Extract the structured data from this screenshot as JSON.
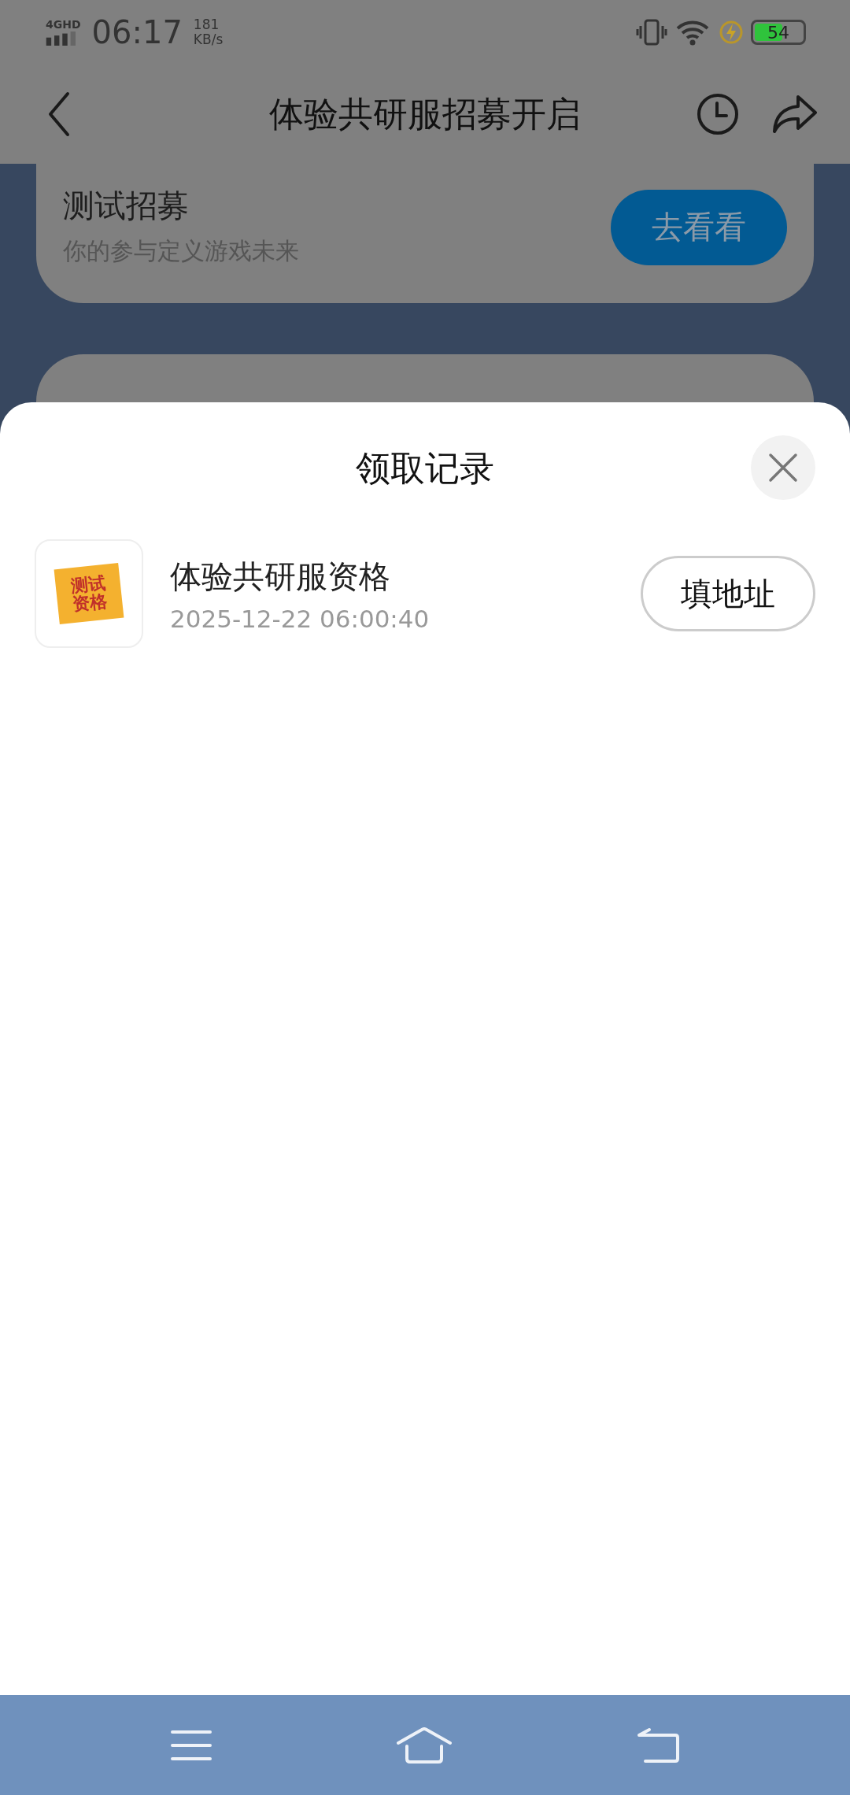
{
  "status_bar": {
    "network": "4GHD",
    "time": "06:17",
    "speed_value": "181",
    "speed_unit": "KB/s",
    "battery": "54"
  },
  "header": {
    "title": "体验共研服招募开启"
  },
  "banner_card": {
    "title": "测试招募",
    "subtitle": "你的参与定义游戏未来",
    "button": "去看看"
  },
  "sheet": {
    "title": "领取记录",
    "records": [
      {
        "name": "体验共研服资格",
        "time": "2025-12-22 06:00:40",
        "button": "填地址",
        "icon_text": "测试资格"
      }
    ]
  }
}
